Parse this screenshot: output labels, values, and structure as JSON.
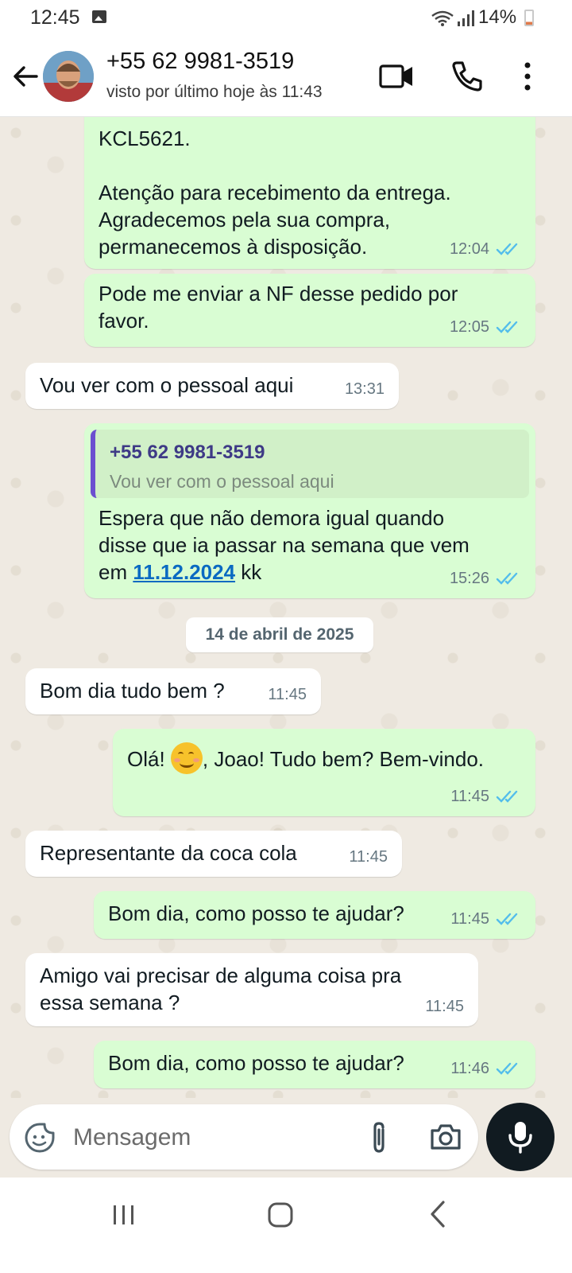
{
  "status_bar": {
    "time": "12:45",
    "battery_text": "14%",
    "signal_icons": [
      "gallery-icon",
      "wifi-icon",
      "signal-icon",
      "battery-icon"
    ]
  },
  "header": {
    "contact_name": "+55 62 9981-3519",
    "last_seen": "visto por último hoje às 11:43",
    "icons": [
      "back-arrow-icon",
      "avatar",
      "video-call-icon",
      "phone-call-icon",
      "more-options-icon"
    ]
  },
  "messages": [
    {
      "dir": "out",
      "text": "KCL5621.\n\nAtenção para recebimento da entrega.\nAgradecemos pela sua compra,\npermanecemos à disposição.",
      "time": "12:04",
      "read": true
    },
    {
      "dir": "out",
      "text": "Pode me enviar a NF desse pedido por\nfavor.",
      "time": "12:05",
      "read": true
    },
    {
      "dir": "in",
      "text": "Vou ver com o pessoal aqui",
      "time": "13:31"
    },
    {
      "dir": "out",
      "quote": {
        "name": "+55 62 9981-3519",
        "text": "Vou ver com o pessoal aqui"
      },
      "text_before_link": "Espera que não demora igual quando\ndisse que ia passar na semana que vem\nem ",
      "link": "11.12.2024",
      "text_after_link": " kk",
      "time": "15:26",
      "read": true
    },
    {
      "dir": "in",
      "text": "Bom dia tudo bem ?",
      "time": "11:45"
    },
    {
      "dir": "out",
      "text_before_emoji": "Olá! ",
      "emoji": "smiling-face-emoji",
      "text_after_emoji": ", Joao! Tudo bem? Bem-vindo.",
      "time": "11:45",
      "read": true
    },
    {
      "dir": "in",
      "text": "Representante da coca cola",
      "time": "11:45"
    },
    {
      "dir": "out",
      "text": "Bom dia, como posso te ajudar?",
      "time": "11:45",
      "read": true
    },
    {
      "dir": "in",
      "text": "Amigo vai precisar de alguma coisa pra\nessa semana ?",
      "time": "11:45"
    },
    {
      "dir": "out",
      "text": "Bom dia, como posso te ajudar?",
      "time": "11:46",
      "read": true
    }
  ],
  "date_separator": "14 de abril de 2025",
  "composer": {
    "placeholder": "Mensagem",
    "icons": [
      "sticker-icon",
      "attach-icon",
      "camera-icon",
      "mic-icon"
    ]
  },
  "navbar": {
    "icons": [
      "recent-apps-icon",
      "home-icon",
      "back-icon"
    ]
  },
  "colors": {
    "chat_background": "#efeae2",
    "outgoing_bubble": "#d9fdd3",
    "incoming_bubble": "#ffffff",
    "read_ticks": "#53bdeb",
    "link": "#0a6ac2",
    "quote_bar": "#6b4fd0"
  }
}
